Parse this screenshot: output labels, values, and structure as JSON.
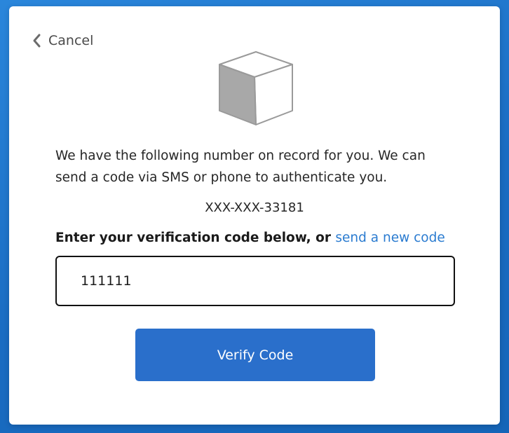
{
  "nav": {
    "cancel_label": "Cancel",
    "back_icon": "chevron-left-icon"
  },
  "illustration": {
    "icon": "cube-icon",
    "colors": {
      "front": "#a8a8a8",
      "top": "#ffffff",
      "side": "#ffffff",
      "stroke": "#9a9a9a"
    }
  },
  "main": {
    "description": "We have the following number on record for you. We can send a code via SMS or phone to authenticate you.",
    "phone_number": "XXX-XXX-33181",
    "prompt_text": "Enter your verification code below, or ",
    "new_code_link": "send a new code",
    "code_value": "111111",
    "verify_button_label": "Verify Code"
  },
  "colors": {
    "accent": "#2a6fcb",
    "link": "#2a7bd0",
    "background": "#1f74c9"
  }
}
